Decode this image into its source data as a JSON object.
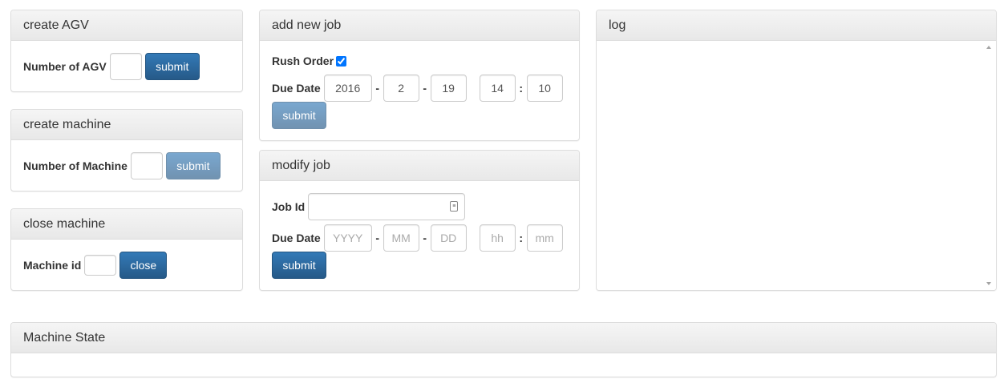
{
  "create_agv": {
    "title": "create AGV",
    "count_label": "Number of AGV",
    "count_value": "",
    "submit_label": "submit"
  },
  "create_machine": {
    "title": "create machine",
    "count_label": "Number of Machine",
    "count_value": "",
    "submit_label": "submit"
  },
  "close_machine": {
    "title": "close machine",
    "id_label": "Machine id",
    "id_value": "",
    "close_label": "close"
  },
  "add_job": {
    "title": "add new job",
    "rush_label": "Rush Order",
    "rush_checked": true,
    "due_label": "Due Date",
    "year": "2016",
    "month": "2",
    "day": "19",
    "hour": "14",
    "minute": "10",
    "date_sep": "-",
    "time_sep": ":",
    "submit_label": "submit"
  },
  "modify_job": {
    "title": "modify job",
    "job_id_label": "Job Id",
    "job_id_value": "",
    "due_label": "Due Date",
    "year_placeholder": "YYYY",
    "month_placeholder": "MM",
    "day_placeholder": "DD",
    "hour_placeholder": "hh",
    "minute_placeholder": "mm",
    "date_sep": "-",
    "time_sep": ":",
    "submit_label": "submit"
  },
  "log": {
    "title": "log",
    "content": ""
  },
  "machine_state": {
    "title": "Machine State"
  },
  "colors": {
    "primary_button": "#337ab7",
    "panel_heading": "#f5f5f5",
    "border": "#dddddd"
  }
}
